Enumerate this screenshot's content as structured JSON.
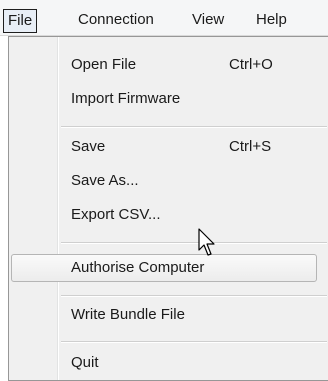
{
  "menubar": {
    "items": [
      "File",
      "Connection",
      "View",
      "Help"
    ]
  },
  "file_menu": {
    "open_file": {
      "label": "Open File",
      "shortcut": "Ctrl+O"
    },
    "import_firmware": {
      "label": "Import Firmware"
    },
    "save": {
      "label": "Save",
      "shortcut": "Ctrl+S"
    },
    "save_as": {
      "label": "Save As..."
    },
    "export_csv": {
      "label": "Export CSV..."
    },
    "authorise_computer": {
      "label": "Authorise Computer"
    },
    "write_bundle_file": {
      "label": "Write Bundle File"
    },
    "quit": {
      "label": "Quit"
    }
  },
  "icons": {
    "cursor": "mouse-pointer-icon"
  }
}
